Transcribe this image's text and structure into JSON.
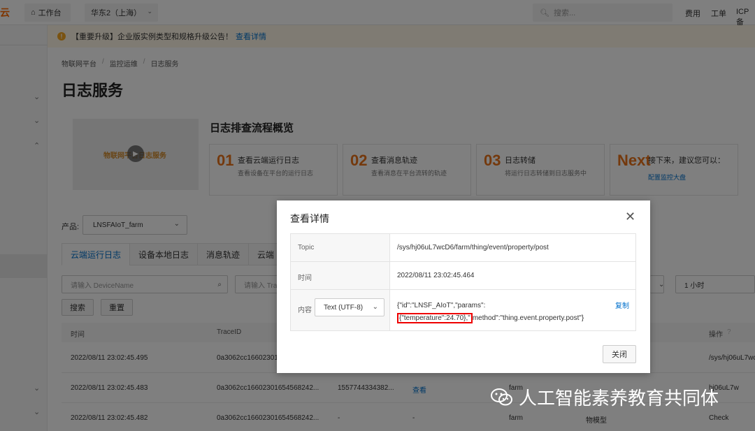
{
  "topbar": {
    "logo": "云",
    "workbench": "工作台",
    "region": "华东2（上海）",
    "search_placeholder": "搜索...",
    "nav": [
      "费用",
      "工单",
      "ICP 备"
    ]
  },
  "notice": {
    "text": "【重要升级】企业版实例类型和规格升级公告！",
    "link": "查看详情"
  },
  "breadcrumb": [
    "物联网平台",
    "监控运维",
    "日志服务"
  ],
  "page_title": "日志服务",
  "video": {
    "caption": "物联网平台日志服务"
  },
  "flow": {
    "title": "日志排查流程概览",
    "steps": [
      {
        "num": "01",
        "title": "查看云端运行日志",
        "desc": "查看设备在平台的运行日志"
      },
      {
        "num": "02",
        "title": "查看消息轨迹",
        "desc": "查看消息在平台流转的轨迹"
      },
      {
        "num": "03",
        "title": "日志转储",
        "desc": "将运行日志转储到日志服务中"
      },
      {
        "num": "Next",
        "title": "接下来，建议您可以：",
        "link": "配置监控大盘"
      }
    ]
  },
  "product": {
    "label": "产品:",
    "value": "LNSFAIoT_farm"
  },
  "tabs": [
    "云端运行日志",
    "设备本地日志",
    "消息轨迹",
    "云端"
  ],
  "filters": {
    "device_placeholder": "请输入 DeviceName",
    "trace_placeholder": "请输入 Trac",
    "time_range": "1 小时",
    "search_btn": "搜索",
    "reset_btn": "重置"
  },
  "table": {
    "headers": [
      "时间",
      "TraceID",
      "操作"
    ],
    "rows": [
      {
        "time": "2022/08/11 23:02:45.495",
        "trace": "0a3062cc16602301",
        "op": "/sys/hj06uL7wc"
      },
      {
        "time": "2022/08/11 23:02:45.483",
        "trace": "0a3062cc16602301654568242...",
        "msg": "1557744334382...",
        "action": "查看",
        "product": "farm",
        "op": "hj06uL7w"
      },
      {
        "time": "2022/08/11 23:02:45.482",
        "trace": "0a3062cc16602301654568242...",
        "msg": "-",
        "action": "-",
        "product": "farm",
        "model": "物模型",
        "op": "Check"
      }
    ]
  },
  "modal": {
    "title": "查看详情",
    "rows": [
      {
        "label": "Topic",
        "value": "/sys/hj06uL7wcD6/farm/thing/event/property/post"
      },
      {
        "label": "时间",
        "value": "2022/08/11 23:02:45.464"
      }
    ],
    "content": {
      "label": "内容",
      "format": "Text (UTF-8)",
      "json_line1": "{\"id\":\"LNSF_AIoT\",\"params\":",
      "json_highlight": "{\"temperature\":24.70},\"",
      "json_rest": "method\":\"thing.event.property.post\"}",
      "copy": "复制"
    },
    "close_btn": "关闭"
  },
  "watermark": "人工智能素养教育共同体",
  "colors": {
    "accent": "#0070cc",
    "orange": "#e8731a",
    "highlight": "#e00000"
  }
}
